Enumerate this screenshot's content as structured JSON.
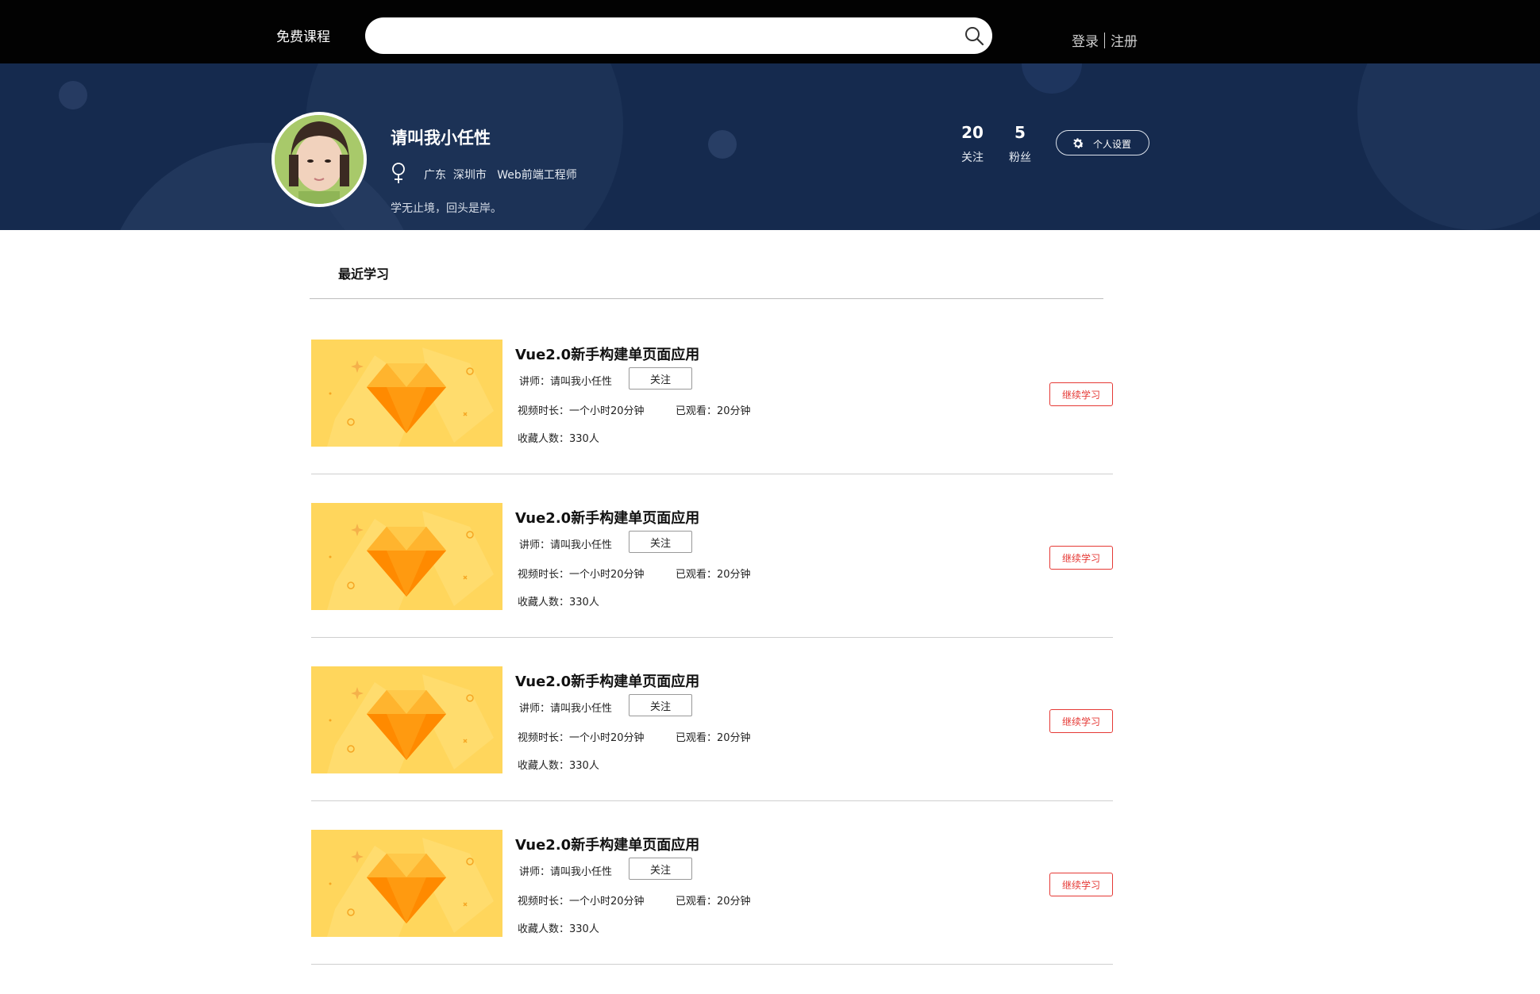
{
  "header": {
    "title": "免费课程",
    "search": {
      "placeholder": "",
      "value": ""
    },
    "login": "登录",
    "register": "注册"
  },
  "profile": {
    "name": "请叫我小任性",
    "location": "广东  深圳市   Web前端工程师",
    "motto": "学无止境，回头是岸。",
    "following_count": "20",
    "following_label": "关注",
    "fans_count": "5",
    "fans_label": "粉丝",
    "settings_label": "个人设置"
  },
  "recent": {
    "title": "最近学习",
    "courses": [
      {
        "title": "Vue2.0新手构建单页面应用",
        "teacher": "讲师：请叫我小任性",
        "follow": "关注",
        "duration": "视频时长：一个小时20分钟",
        "watched": "已观看：20分钟",
        "collect": "收藏人数：330人",
        "continue": "继续学习"
      },
      {
        "title": "Vue2.0新手构建单页面应用",
        "teacher": "讲师：请叫我小任性",
        "follow": "关注",
        "duration": "视频时长：一个小时20分钟",
        "watched": "已观看：20分钟",
        "collect": "收藏人数：330人",
        "continue": "继续学习"
      },
      {
        "title": "Vue2.0新手构建单页面应用",
        "teacher": "讲师：请叫我小任性",
        "follow": "关注",
        "duration": "视频时长：一个小时20分钟",
        "watched": "已观看：20分钟",
        "collect": "收藏人数：330人",
        "continue": "继续学习"
      },
      {
        "title": "Vue2.0新手构建单页面应用",
        "teacher": "讲师：请叫我小任性",
        "follow": "关注",
        "duration": "视频时长：一个小时20分钟",
        "watched": "已观看：20分钟",
        "collect": "收藏人数：330人",
        "continue": "继续学习"
      }
    ]
  },
  "colors": {
    "topbar": "#020202",
    "hero": "#152a4e",
    "accent_red": "#e53935",
    "thumb_bg": "#ffd65c"
  },
  "icons": [
    "search-icon",
    "female-icon",
    "gear-icon",
    "diamond-icon"
  ]
}
